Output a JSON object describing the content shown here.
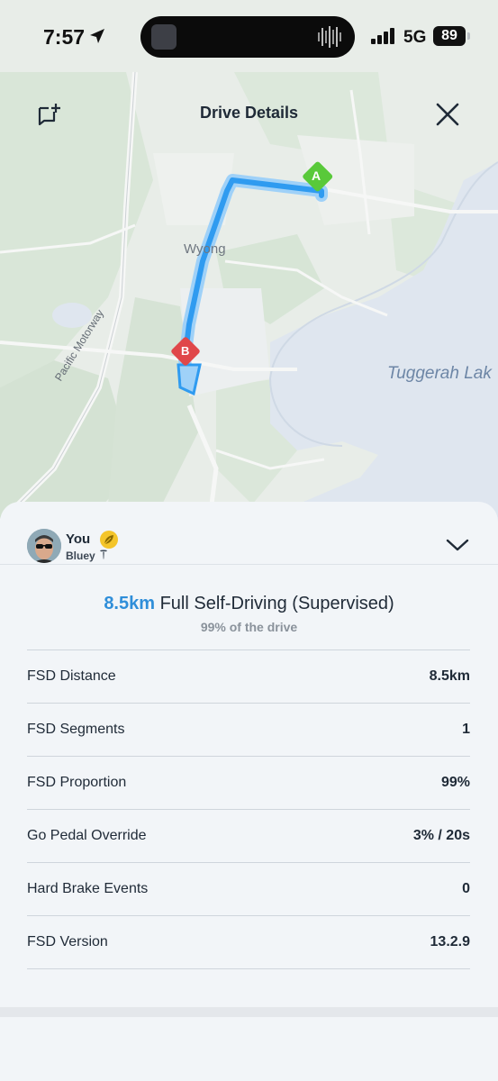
{
  "status_bar": {
    "time": "7:57",
    "network": "5G",
    "battery": "89"
  },
  "header": {
    "title": "Drive Details"
  },
  "map": {
    "lake_label": "Tuggerah Lak",
    "town_label": "Wyong",
    "road_label": "Pacific Motorway",
    "start_marker": "A",
    "end_marker": "B",
    "route_color": "#2f9bf0",
    "start_color": "#59c93a",
    "end_color": "#e0474a"
  },
  "driver": {
    "name": "You",
    "car": "Bluey"
  },
  "summary": {
    "distance": "8.5km",
    "mode": "Full Self-Driving (Supervised)",
    "subtitle": "99% of the drive"
  },
  "stats": [
    {
      "label": "FSD Distance",
      "value": "8.5km"
    },
    {
      "label": "FSD Segments",
      "value": "1"
    },
    {
      "label": "FSD Proportion",
      "value": "99%"
    },
    {
      "label": "Go Pedal Override",
      "value": "3% / 20s"
    },
    {
      "label": "Hard Brake Events",
      "value": "0"
    },
    {
      "label": "FSD Version",
      "value": "13.2.9"
    }
  ],
  "colors": {
    "accent": "#2f8ed9",
    "text": "#1f2a37",
    "muted": "#8a929b"
  }
}
